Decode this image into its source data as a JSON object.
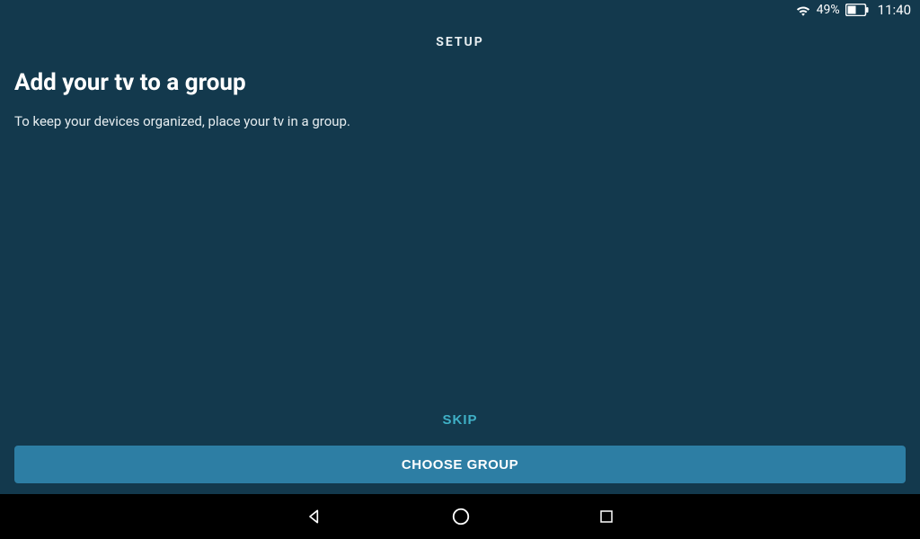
{
  "status": {
    "battery_pct": "49%",
    "time": "11:40"
  },
  "header": {
    "label": "SETUP"
  },
  "page": {
    "title": "Add your tv to a group",
    "description": "To keep your devices organized, place your tv in a group."
  },
  "actions": {
    "skip_label": "SKIP",
    "primary_label": "CHOOSE GROUP"
  }
}
